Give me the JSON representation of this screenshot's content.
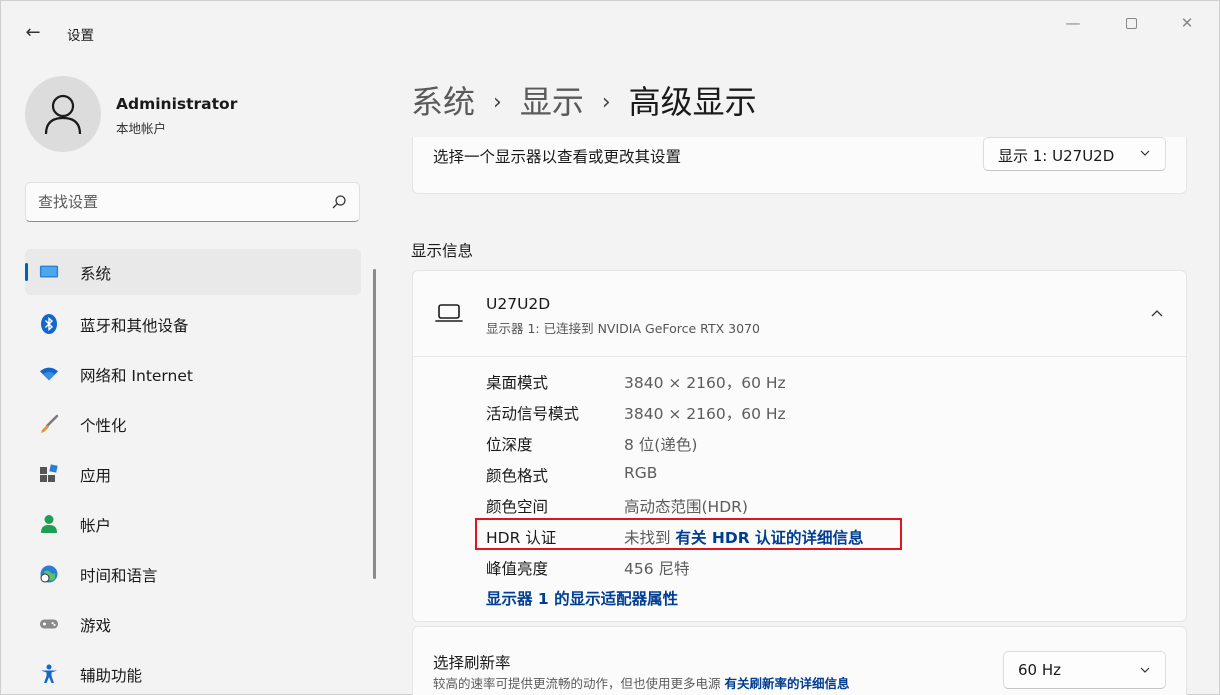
{
  "window": {
    "title": "设置",
    "back_icon": "←",
    "minimize_icon": "—",
    "close_icon": "✕"
  },
  "profile": {
    "name": "Administrator",
    "account_type": "本地帐户"
  },
  "search": {
    "placeholder": "查找设置"
  },
  "sidebar": {
    "items": [
      {
        "label": "系统",
        "icon": "display-icon",
        "active": true
      },
      {
        "label": "蓝牙和其他设备",
        "icon": "bluetooth-icon"
      },
      {
        "label": "网络和 Internet",
        "icon": "wifi-icon"
      },
      {
        "label": "个性化",
        "icon": "brush-icon"
      },
      {
        "label": "应用",
        "icon": "apps-icon"
      },
      {
        "label": "帐户",
        "icon": "person-icon"
      },
      {
        "label": "时间和语言",
        "icon": "globe-clock-icon"
      },
      {
        "label": "游戏",
        "icon": "gamepad-icon"
      },
      {
        "label": "辅助功能",
        "icon": "accessibility-icon"
      }
    ]
  },
  "breadcrumb": {
    "level1": "系统",
    "level2": "显示",
    "current": "高级显示",
    "separator": "›"
  },
  "monitor_select": {
    "label": "选择一个显示器以查看或更改其设置",
    "value": "显示 1: U27U2D"
  },
  "display_info": {
    "section_title": "显示信息",
    "monitor_name": "U27U2D",
    "monitor_sub": "显示器 1: 已连接到 NVIDIA GeForce RTX 3070",
    "rows": [
      {
        "key": "桌面模式",
        "value": "3840 × 2160，60 Hz"
      },
      {
        "key": "活动信号模式",
        "value": "3840 × 2160，60 Hz"
      },
      {
        "key": "位深度",
        "value": "8 位(递色)"
      },
      {
        "key": "颜色格式",
        "value": "RGB"
      },
      {
        "key": "颜色空间",
        "value": "高动态范围(HDR)"
      },
      {
        "key": "HDR 认证",
        "value": "未找到",
        "link": "有关 HDR 认证的详细信息"
      },
      {
        "key": "峰值亮度",
        "value": "456 尼特"
      }
    ],
    "adapter_link": "显示器 1 的显示适配器属性"
  },
  "refresh_rate": {
    "title": "选择刷新率",
    "description": "较高的速率可提供更流畅的动作，但也使用更多电源",
    "link": "有关刷新率的详细信息",
    "value": "60 Hz"
  },
  "colors": {
    "accent": "#005fb8",
    "link": "#003e92",
    "highlight_box": "#e0141e"
  }
}
